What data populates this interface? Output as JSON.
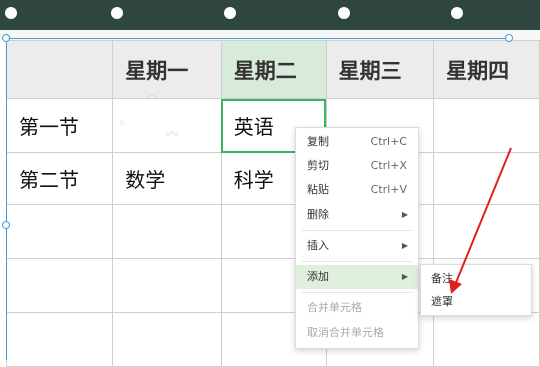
{
  "table": {
    "headers": [
      "",
      "星期一",
      "星期二",
      "星期三",
      "星期四"
    ],
    "rows": [
      [
        "第一节",
        "",
        "英语",
        "",
        ""
      ],
      [
        "第二节",
        "数学",
        "科学",
        "",
        ""
      ],
      [
        "",
        "",
        "",
        "",
        ""
      ],
      [
        "",
        "",
        "",
        "",
        ""
      ],
      [
        "",
        "",
        "",
        "",
        ""
      ]
    ]
  },
  "context_menu": {
    "items": [
      {
        "label": "复制",
        "shortcut": "Ctrl+C"
      },
      {
        "label": "剪切",
        "shortcut": "Ctrl+X"
      },
      {
        "label": "粘贴",
        "shortcut": "Ctrl+V"
      },
      {
        "label": "删除",
        "submenu": true
      },
      {
        "label": "插入",
        "submenu": true
      },
      {
        "label": "添加",
        "submenu": true,
        "highlighted": true
      },
      {
        "label": "合并单元格",
        "disabled": true
      },
      {
        "label": "取消合并单元格",
        "disabled": true
      }
    ],
    "submenu_items": [
      "备注",
      "遮罩"
    ]
  },
  "colors": {
    "top_bar": "#2e4540",
    "selection_border": "#3bb55e",
    "menu_highlight": "#dff0dc",
    "annotation_arrow": "#e02020"
  }
}
